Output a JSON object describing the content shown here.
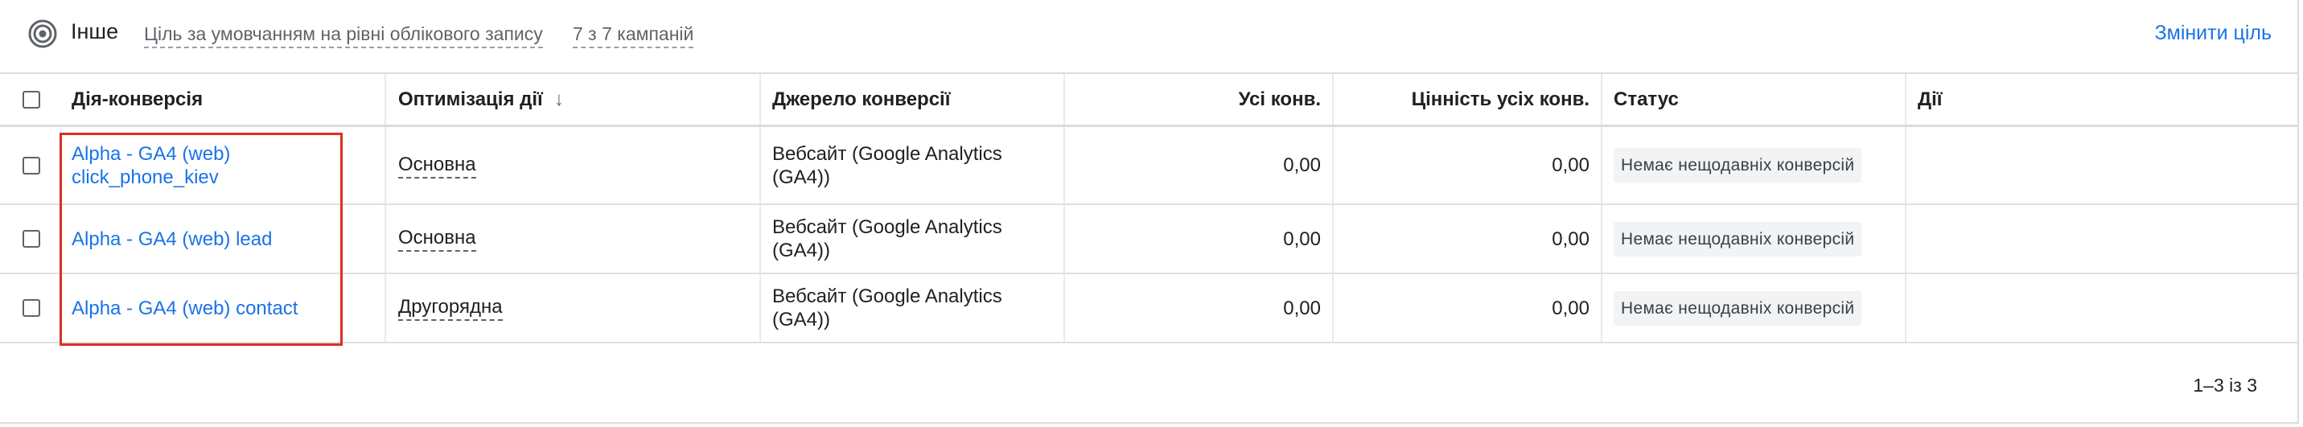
{
  "header": {
    "goal_icon": "target-icon",
    "title": "Інше",
    "subtitle": "Ціль за умовчанням на рівні облікового запису",
    "campaigns": "7 з 7 кампаній",
    "change_goal": "Змінити ціль"
  },
  "columns": {
    "action": "Дія-конверсія",
    "optimization": "Оптимізація дії",
    "sort_icon": "arrow-down-icon",
    "source": "Джерело конверсії",
    "all_conv": "Усі конв.",
    "all_value": "Цінність усіх конв.",
    "status": "Статус",
    "actions": "Дії"
  },
  "rows": [
    {
      "name": "Alpha - GA4 (web) click_phone_kiev",
      "optimization": "Основна",
      "source": "Вебсайт (Google Analytics (GA4))",
      "all_conv": "0,00",
      "all_value": "0,00",
      "status": "Немає нещодавніх конверсій"
    },
    {
      "name": "Alpha - GA4 (web) lead",
      "optimization": "Основна",
      "source": "Вебсайт (Google Analytics (GA4))",
      "all_conv": "0,00",
      "all_value": "0,00",
      "status": "Немає нещодавніх конверсій"
    },
    {
      "name": "Alpha - GA4 (web) contact",
      "optimization": "Другорядна",
      "source": "Вебсайт (Google Analytics (GA4))",
      "all_conv": "0,00",
      "all_value": "0,00",
      "status": "Немає нещодавніх конверсій"
    }
  ],
  "pagination": "1–3 із 3",
  "colors": {
    "link": "#1a73e8",
    "highlight": "#d93025"
  }
}
